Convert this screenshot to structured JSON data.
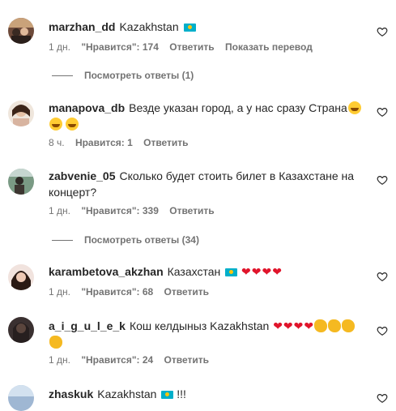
{
  "comments": [
    {
      "username": "marzhan_dd",
      "text": "Kazakhstan",
      "flag": true,
      "time": "1 дн.",
      "likes": "\"Нравится\": 174",
      "reply": "Ответить",
      "translate": "Показать перевод",
      "view_replies": "Посмотреть ответы (1)"
    },
    {
      "username": "manapova_db",
      "text": "Везде указан город, а у нас сразу Страна",
      "time": "8 ч.",
      "likes": "Нравится: 1",
      "reply": "Ответить"
    },
    {
      "username": "zabvenie_05",
      "text": "Сколько будет стоить билет в Казахстане на концерт?",
      "time": "1 дн.",
      "likes": "\"Нравится\": 339",
      "reply": "Ответить",
      "view_replies": "Посмотреть ответы (34)"
    },
    {
      "username": "karambetova_akzhan",
      "text": "Казахстан",
      "time": "1 дн.",
      "likes": "\"Нравится\": 68",
      "reply": "Ответить"
    },
    {
      "username": "a_i_g_u_l_e_k",
      "text": "Кош келдыныз Kazakhstan",
      "time": "1 дн.",
      "likes": "\"Нравится\": 24",
      "reply": "Ответить"
    },
    {
      "username": "zhaskuk",
      "text": "Kazakhstan",
      "suffix": "!!!"
    }
  ],
  "colors": {
    "heart_emoji": "#e0142b",
    "flag_blue": "#00afca",
    "flag_sun": "#fec50c",
    "meta_gray": "#737373"
  },
  "icons": {
    "like": "heart-outline-icon"
  }
}
